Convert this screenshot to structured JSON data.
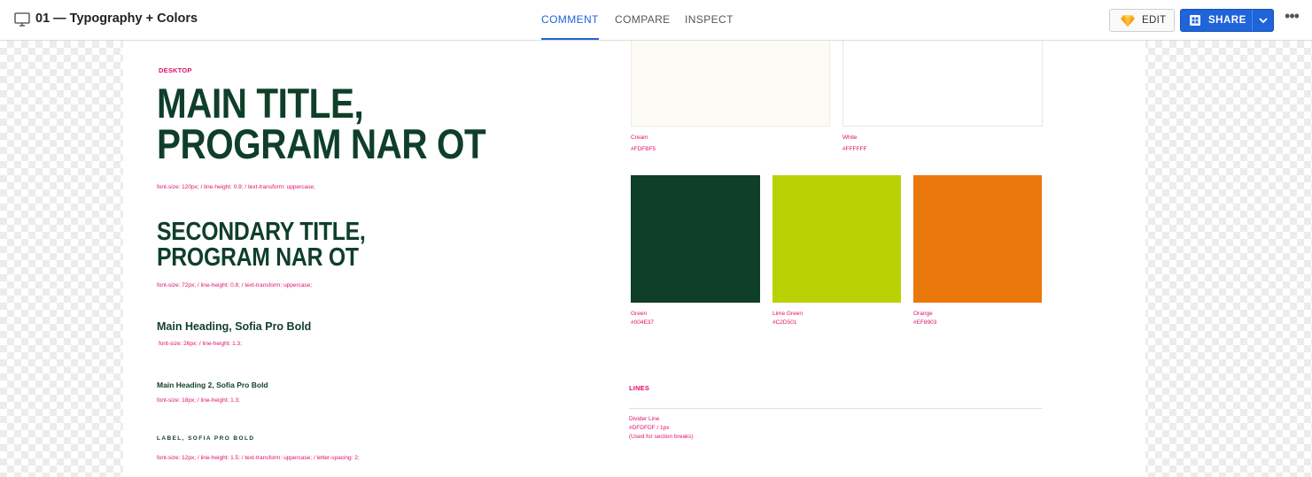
{
  "header": {
    "title": "01 — Typography + Colors",
    "icon": "desktop-monitor-icon",
    "tabs": [
      {
        "label": "COMMENT",
        "active": true
      },
      {
        "label": "COMPARE",
        "active": false
      },
      {
        "label": "INSPECT",
        "active": false
      }
    ],
    "edit_label": "EDIT",
    "share_label": "SHARE",
    "more_label": "•••",
    "accent_color": "#1F64D8"
  },
  "typography": {
    "section_label": "DESKTOP",
    "main_title_line1": "MAIN TITLE,",
    "main_title_line2": "PROGRAM NAR OT",
    "main_title_spec": "font-size: 120px; / line-height: 0.9; / text-transform: uppercase;",
    "secondary_title_line1": "SECONDARY TITLE,",
    "secondary_title_line2": "PROGRAM NAR OT",
    "secondary_title_spec": "font-size: 72px; / line-height: 0.8; / text-transform: uppercase;",
    "heading1": "Main Heading, Sofia Pro Bold",
    "heading1_spec": "font-size: 26px; / line-height: 1.3;",
    "heading2": "Main Heading 2, Sofia Pro Bold",
    "heading2_spec": "font-size: 18px; / line-height: 1.3;",
    "label": "LABEL, SOFIA PRO BOLD",
    "label_spec": "font-size: 12px; / line-height: 1.5; / text-transform: uppercase; / letter-spacing: 2;"
  },
  "colors": {
    "swatches": [
      {
        "name": "Cream",
        "hex": "#FDFBF5",
        "color": "#FDFBF5"
      },
      {
        "name": "White",
        "hex": "#FFFFFF",
        "color": "#FFFFFF"
      },
      {
        "name": "Green",
        "hex": "#004E37",
        "color": "#0F3F29"
      },
      {
        "name": "Lime Green",
        "hex": "#C2D501",
        "color": "#BAD104"
      },
      {
        "name": "Orange",
        "hex": "#EF8903",
        "color": "#EA780B"
      }
    ]
  },
  "lines": {
    "section_label": "LINES",
    "divider_name": "Divider Line",
    "divider_spec": "#DFDFDF / 1px",
    "divider_usage": "(Used for section breaks)",
    "divider_color": "#DFDFDF"
  },
  "theme": {
    "pink": "#E0106B",
    "dark_green": "#0F3F29"
  }
}
